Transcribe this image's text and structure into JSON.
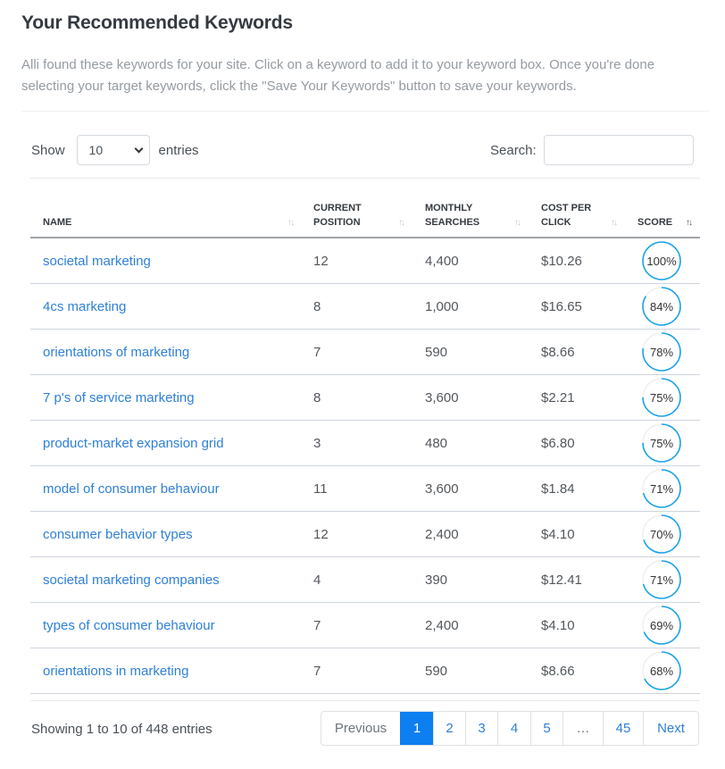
{
  "header": {
    "title": "Your Recommended Keywords",
    "description": "Alli found these keywords for your site. Click on a keyword to add it to your keyword box. Once you're done selecting your target keywords, click the \"Save Your Keywords\" button to save your keywords."
  },
  "controls": {
    "show_label": "Show",
    "entries_value": "10",
    "entries_label": "entries",
    "search_label": "Search:",
    "search_value": ""
  },
  "table": {
    "columns": [
      {
        "line1": "NAME",
        "line2": "",
        "sorted": false
      },
      {
        "line1": "CURRENT",
        "line2": "POSITION",
        "sorted": false
      },
      {
        "line1": "MONTHLY",
        "line2": "SEARCHES",
        "sorted": false
      },
      {
        "line1": "COST PER",
        "line2": "CLICK",
        "sorted": false
      },
      {
        "line1": "SCORE",
        "line2": "",
        "sorted": true,
        "direction": "desc"
      }
    ],
    "sort_icon": "↑↓",
    "rows": [
      {
        "name": "societal marketing",
        "position": "12",
        "searches": "4,400",
        "cpc": "$10.26",
        "score": 100,
        "score_label": "100%"
      },
      {
        "name": "4cs marketing",
        "position": "8",
        "searches": "1,000",
        "cpc": "$16.65",
        "score": 84,
        "score_label": "84%"
      },
      {
        "name": "orientations of marketing",
        "position": "7",
        "searches": "590",
        "cpc": "$8.66",
        "score": 78,
        "score_label": "78%"
      },
      {
        "name": "7 p's of service marketing",
        "position": "8",
        "searches": "3,600",
        "cpc": "$2.21",
        "score": 75,
        "score_label": "75%"
      },
      {
        "name": "product-market expansion grid",
        "position": "3",
        "searches": "480",
        "cpc": "$6.80",
        "score": 75,
        "score_label": "75%"
      },
      {
        "name": "model of consumer behaviour",
        "position": "11",
        "searches": "3,600",
        "cpc": "$1.84",
        "score": 71,
        "score_label": "71%"
      },
      {
        "name": "consumer behavior types",
        "position": "12",
        "searches": "2,400",
        "cpc": "$4.10",
        "score": 70,
        "score_label": "70%"
      },
      {
        "name": "societal marketing companies",
        "position": "4",
        "searches": "390",
        "cpc": "$12.41",
        "score": 71,
        "score_label": "71%"
      },
      {
        "name": "types of consumer behaviour",
        "position": "7",
        "searches": "2,400",
        "cpc": "$4.10",
        "score": 69,
        "score_label": "69%"
      },
      {
        "name": "orientations in marketing",
        "position": "7",
        "searches": "590",
        "cpc": "$8.66",
        "score": 68,
        "score_label": "68%"
      }
    ]
  },
  "footer": {
    "info": "Showing 1 to 10 of 448 entries",
    "pagination": [
      {
        "label": "Previous",
        "state": "disabled"
      },
      {
        "label": "1",
        "state": "active"
      },
      {
        "label": "2",
        "state": "normal"
      },
      {
        "label": "3",
        "state": "normal"
      },
      {
        "label": "4",
        "state": "normal"
      },
      {
        "label": "5",
        "state": "normal"
      },
      {
        "label": "…",
        "state": "ellipsis"
      },
      {
        "label": "45",
        "state": "normal"
      },
      {
        "label": "Next",
        "state": "normal"
      }
    ]
  },
  "colors": {
    "link": "#2f80d8",
    "accent": "#0d7ff0",
    "score_ring": "#1ba3e8",
    "score_track": "#f0f0f0"
  }
}
